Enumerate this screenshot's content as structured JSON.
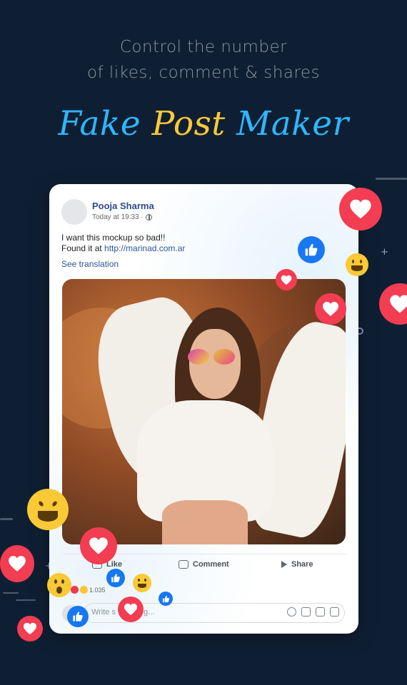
{
  "header": {
    "subtitle_line1": "Control the number",
    "subtitle_line2": "of likes, comment & shares",
    "title_word1": "Fake",
    "title_word2": "Post",
    "title_word3": "Maker"
  },
  "post": {
    "author": "Pooja Sharma",
    "time": "Today at 19:33 ·",
    "text_line1": "I want this mockup so bad!!",
    "text_line2_prefix": "Found it at ",
    "link": "http://marinad.com.ar",
    "see_translation": "See translation",
    "reaction_count": "1.035",
    "actions": {
      "like": "Like",
      "comment": "Comment",
      "share": "Share"
    },
    "write_placeholder": "Write s",
    "write_placeholder_tail": "g..."
  },
  "icons": {
    "heart": "heart-icon",
    "like": "thumbs-up-icon",
    "haha": "laughing-emoji-icon",
    "wow": "wow-emoji-icon"
  },
  "colors": {
    "background": "#0f1f33",
    "title_blue": "#2fb6ff",
    "title_yellow": "#ffc83a",
    "heart_red": "#f33d52",
    "like_blue": "#1877f2",
    "link_blue": "#2d55a0"
  }
}
